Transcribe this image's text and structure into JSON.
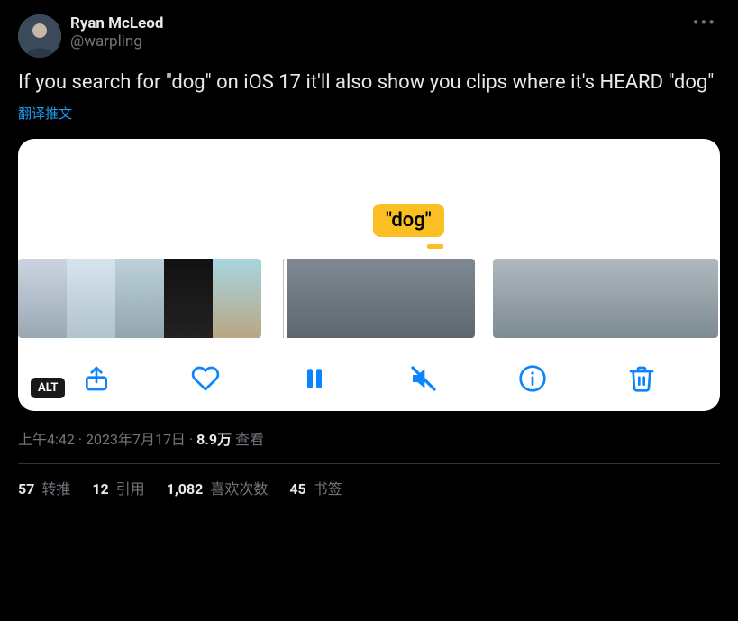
{
  "user": {
    "display_name": "Ryan McLeod",
    "handle": "@warpling"
  },
  "tweet_text": "If you search for \"dog\" on iOS 17 it'll also show you clips where it's HEARD \"dog\"",
  "translate_label": "翻译推文",
  "media": {
    "search_term_label": "\"dog\"",
    "alt_badge": "ALT"
  },
  "timestamp": {
    "time": "上午4:42",
    "date": "2023年7月17日",
    "dot": " · ",
    "views_count": "8.9万",
    "views_label": " 查看"
  },
  "stats": {
    "retweets": {
      "count": "57",
      "label": " 转推"
    },
    "quotes": {
      "count": "12",
      "label": " 引用"
    },
    "likes": {
      "count": "1,082",
      "label": " 喜欢次数"
    },
    "bookmarks": {
      "count": "45",
      "label": " 书签"
    }
  }
}
